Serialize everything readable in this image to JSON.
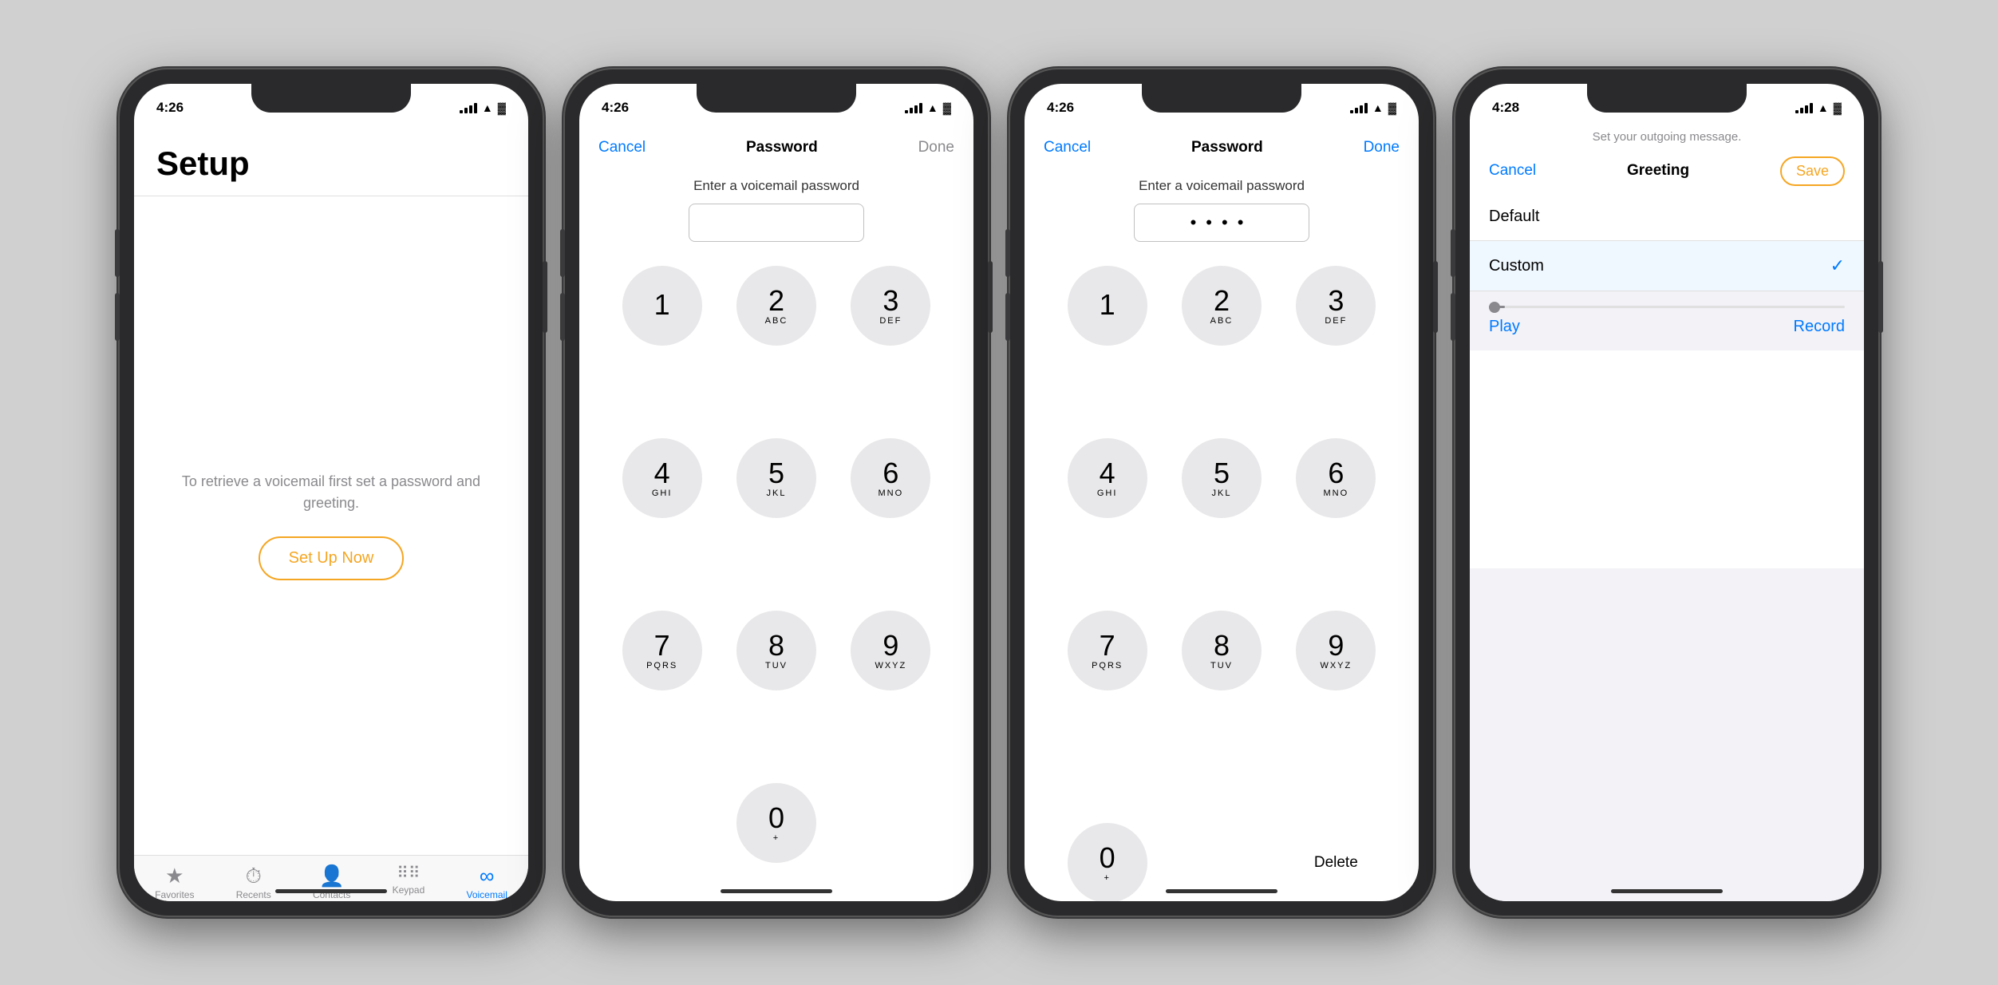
{
  "phones": [
    {
      "id": "phone-setup",
      "status_time": "4:26",
      "screen": "setup",
      "setup": {
        "title": "Setup",
        "description": "To retrieve a voicemail\nfirst set a password\nand greeting.",
        "button_label": "Set Up Now"
      },
      "tabs": [
        {
          "label": "Favorites",
          "icon": "★",
          "active": false
        },
        {
          "label": "Recents",
          "icon": "🕐",
          "active": false
        },
        {
          "label": "Contacts",
          "icon": "👤",
          "active": false
        },
        {
          "label": "Keypad",
          "icon": "⠿",
          "active": false
        },
        {
          "label": "Voicemail",
          "icon": "⌁",
          "active": true
        }
      ]
    },
    {
      "id": "phone-password-empty",
      "status_time": "4:26",
      "screen": "password-empty",
      "nav": {
        "cancel": "Cancel",
        "title": "Password",
        "done": "Done",
        "done_active": false
      },
      "hint": "Enter a voicemail password",
      "password_value": "",
      "keypad": {
        "keys": [
          {
            "num": "1",
            "sub": ""
          },
          {
            "num": "2",
            "sub": "ABC"
          },
          {
            "num": "3",
            "sub": "DEF"
          },
          {
            "num": "4",
            "sub": "GHI"
          },
          {
            "num": "5",
            "sub": "JKL"
          },
          {
            "num": "6",
            "sub": "MNO"
          },
          {
            "num": "7",
            "sub": "PQRS"
          },
          {
            "num": "8",
            "sub": "TUV"
          },
          {
            "num": "9",
            "sub": "WXYZ"
          },
          {
            "num": "0",
            "sub": "+"
          }
        ]
      }
    },
    {
      "id": "phone-password-filled",
      "status_time": "4:26",
      "screen": "password-filled",
      "nav": {
        "cancel": "Cancel",
        "title": "Password",
        "done": "Done",
        "done_active": true
      },
      "hint": "Enter a voicemail password",
      "password_value": "••••",
      "keypad": {
        "keys": [
          {
            "num": "1",
            "sub": ""
          },
          {
            "num": "2",
            "sub": "ABC"
          },
          {
            "num": "3",
            "sub": "DEF"
          },
          {
            "num": "4",
            "sub": "GHI"
          },
          {
            "num": "5",
            "sub": "JKL"
          },
          {
            "num": "6",
            "sub": "MNO"
          },
          {
            "num": "7",
            "sub": "PQRS"
          },
          {
            "num": "8",
            "sub": "TUV"
          },
          {
            "num": "9",
            "sub": "WXYZ"
          },
          {
            "num": "0",
            "sub": "+"
          }
        ],
        "delete_label": "Delete"
      }
    },
    {
      "id": "phone-greeting",
      "status_time": "4:28",
      "screen": "greeting",
      "hint": "Set your outgoing message.",
      "nav": {
        "cancel": "Cancel",
        "title": "Greeting",
        "save": "Save"
      },
      "options": [
        {
          "label": "Default",
          "selected": false
        },
        {
          "label": "Custom",
          "selected": true
        }
      ],
      "player": {
        "play_label": "Play",
        "record_label": "Record"
      }
    }
  ]
}
